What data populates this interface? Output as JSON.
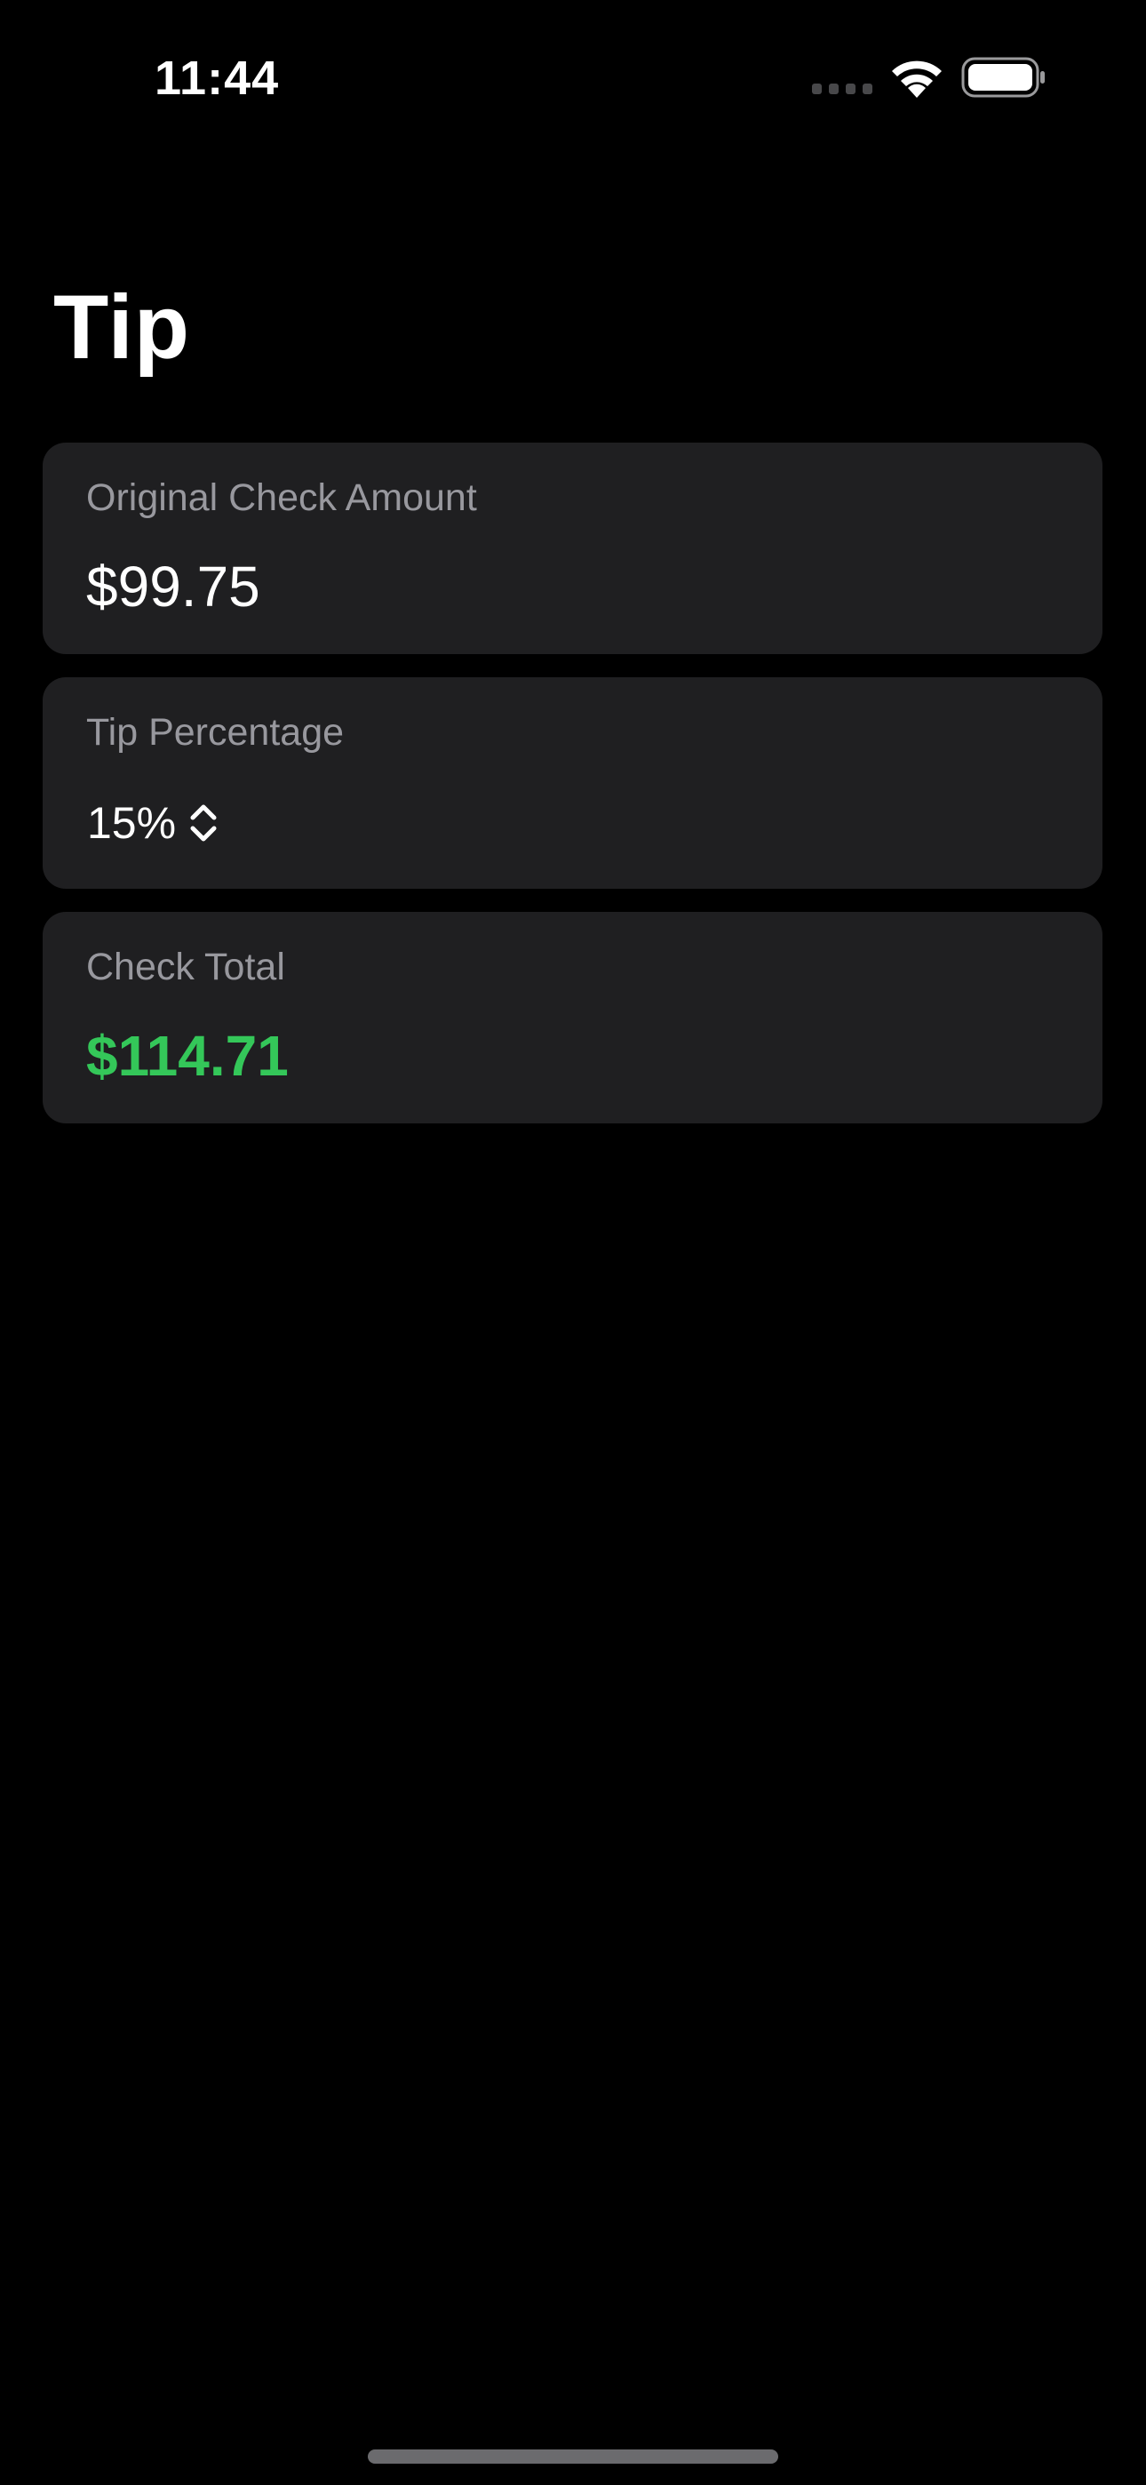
{
  "status_bar": {
    "time": "11:44",
    "icons": [
      "cellular-signal-icon",
      "wifi-icon",
      "battery-icon"
    ]
  },
  "page": {
    "title": "Tip"
  },
  "cards": {
    "original": {
      "label": "Original Check Amount",
      "value": "$99.75"
    },
    "tip": {
      "label": "Tip Percentage",
      "value": "15%",
      "icon": "chevron-up-down-icon"
    },
    "total": {
      "label": "Check Total",
      "value": "$114.71"
    }
  },
  "colors": {
    "background": "#000000",
    "card": "#1f1f21",
    "label": "#98989e",
    "total_accent": "#34c759"
  }
}
